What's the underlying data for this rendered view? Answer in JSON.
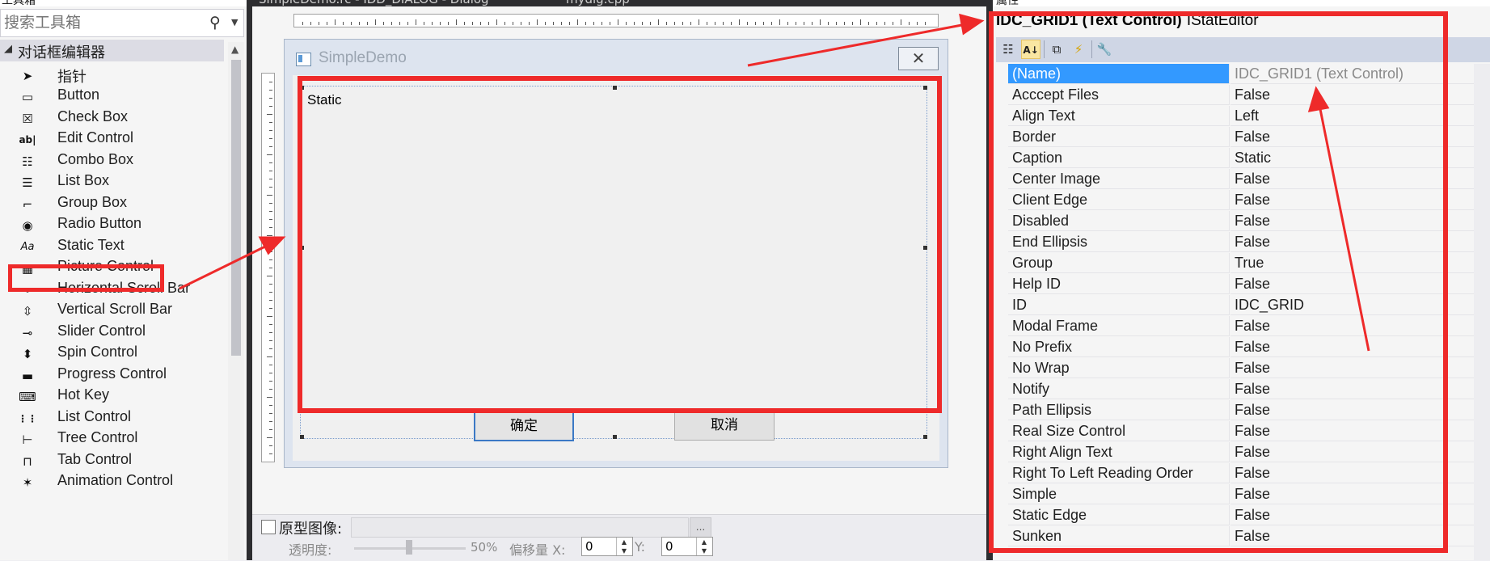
{
  "toolbox": {
    "title": "工具箱",
    "search_placeholder": "搜索工具箱",
    "group_label": "对话框编辑器",
    "items": [
      {
        "icon": "pointer-icon",
        "glyph": "➤",
        "label": "指针"
      },
      {
        "icon": "button-icon",
        "glyph": "▭",
        "label": "Button"
      },
      {
        "icon": "checkbox-icon",
        "glyph": "☒",
        "label": "Check Box"
      },
      {
        "icon": "edit-control-icon",
        "glyph": "ab|",
        "label": "Edit Control"
      },
      {
        "icon": "combo-box-icon",
        "glyph": "☷",
        "label": "Combo Box"
      },
      {
        "icon": "list-box-icon",
        "glyph": "☰",
        "label": "List Box"
      },
      {
        "icon": "group-box-icon",
        "glyph": "⌐",
        "label": "Group Box"
      },
      {
        "icon": "radio-button-icon",
        "glyph": "◉",
        "label": "Radio Button"
      },
      {
        "icon": "static-text-icon",
        "glyph": "Aa",
        "label": "Static Text"
      },
      {
        "icon": "picture-control-icon",
        "glyph": "▦",
        "label": "Picture Control"
      },
      {
        "icon": "horizontal-scroll-bar-icon",
        "glyph": "◂▸",
        "label": "Horizontal Scroll Bar"
      },
      {
        "icon": "vertical-scroll-bar-icon",
        "glyph": "⇳",
        "label": "Vertical Scroll Bar"
      },
      {
        "icon": "slider-control-icon",
        "glyph": "⊸",
        "label": "Slider Control"
      },
      {
        "icon": "spin-control-icon",
        "glyph": "⬍",
        "label": "Spin Control"
      },
      {
        "icon": "progress-control-icon",
        "glyph": "▬",
        "label": "Progress Control"
      },
      {
        "icon": "hot-key-icon",
        "glyph": "⌨",
        "label": "Hot Key"
      },
      {
        "icon": "list-control-icon",
        "glyph": "⋮⋮",
        "label": "List Control"
      },
      {
        "icon": "tree-control-icon",
        "glyph": "⊢",
        "label": "Tree Control"
      },
      {
        "icon": "tab-control-icon",
        "glyph": "⊓",
        "label": "Tab Control"
      },
      {
        "icon": "animation-control-icon",
        "glyph": "✶",
        "label": "Animation Control"
      }
    ]
  },
  "editor": {
    "tabs": [
      "SimpleDemo.rc - IDD_DIALOG - Dialog",
      "mydlg.cpp"
    ],
    "dialog": {
      "title": "SimpleDemo",
      "close_glyph": "✕",
      "static_label": "Static",
      "ok_label": "确定",
      "cancel_label": "取消"
    },
    "bottom": {
      "prototype_label": "原型图像:",
      "prototype_browse": "...",
      "opacity_label": "透明度:",
      "opacity_value": "50%",
      "opacity_level": 0.5,
      "offset_label": "偏移量 X:",
      "offset_x": "0",
      "y_label": "Y:",
      "offset_y": "0"
    }
  },
  "properties": {
    "title": "属性",
    "object_name": "IDC_GRID1 (Text Control)",
    "object_type": "IStatEditor",
    "toolbar": [
      {
        "icon": "categorized-icon",
        "glyph": "☷"
      },
      {
        "icon": "alphabetical-icon",
        "glyph": "A↓"
      },
      {
        "icon": "property-pages-icon",
        "glyph": "⧉"
      },
      {
        "icon": "events-icon",
        "glyph": "⚡"
      },
      {
        "icon": "wrench-icon",
        "glyph": "🔧"
      }
    ],
    "rows": [
      {
        "name": "(Name)",
        "value": "IDC_GRID1 (Text Control)"
      },
      {
        "name": "Acccept Files",
        "value": "False"
      },
      {
        "name": "Align Text",
        "value": "Left"
      },
      {
        "name": "Border",
        "value": "False"
      },
      {
        "name": "Caption",
        "value": "Static"
      },
      {
        "name": "Center Image",
        "value": "False"
      },
      {
        "name": "Client Edge",
        "value": "False"
      },
      {
        "name": "Disabled",
        "value": "False"
      },
      {
        "name": "End Ellipsis",
        "value": "False"
      },
      {
        "name": "Group",
        "value": "True"
      },
      {
        "name": "Help ID",
        "value": "False"
      },
      {
        "name": "ID",
        "value": "IDC_GRID"
      },
      {
        "name": "Modal Frame",
        "value": "False"
      },
      {
        "name": "No Prefix",
        "value": "False"
      },
      {
        "name": "No Wrap",
        "value": "False"
      },
      {
        "name": "Notify",
        "value": "False"
      },
      {
        "name": "Path Ellipsis",
        "value": "False"
      },
      {
        "name": "Real Size Control",
        "value": "False"
      },
      {
        "name": "Right Align Text",
        "value": "False"
      },
      {
        "name": "Right To Left Reading Order",
        "value": "False"
      },
      {
        "name": "Simple",
        "value": "False"
      },
      {
        "name": "Static Edge",
        "value": "False"
      },
      {
        "name": "Sunken",
        "value": "False"
      }
    ]
  },
  "annotation_color": "#ee2a2a"
}
